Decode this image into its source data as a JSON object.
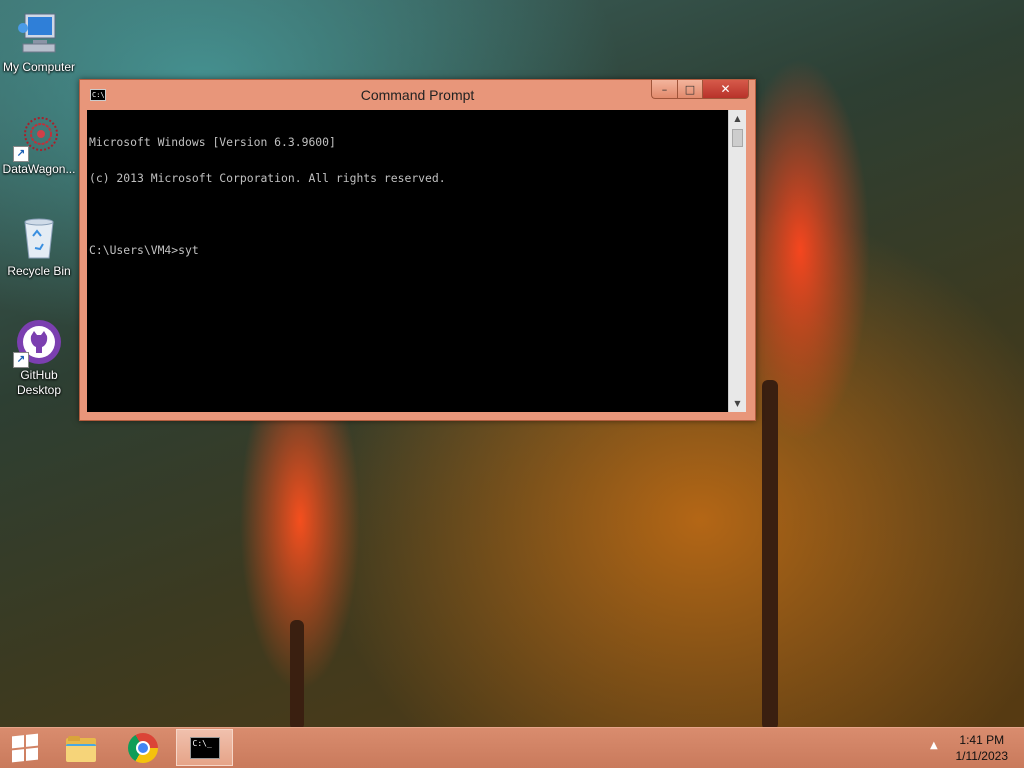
{
  "desktop": {
    "icons": [
      {
        "label": "My Computer",
        "icon": "computer-icon"
      },
      {
        "label": "DataWagon...",
        "icon": "datawagon-icon"
      },
      {
        "label": "Recycle Bin",
        "icon": "recycle-bin-icon"
      },
      {
        "label": "GitHub Desktop",
        "icon": "github-desktop-icon"
      }
    ]
  },
  "window": {
    "title": "Command Prompt",
    "title_icon_text": "C:\\",
    "minimize_glyph": "–",
    "maximize_glyph": "□",
    "close_glyph": "✕",
    "console_lines": [
      "Microsoft Windows [Version 6.3.9600]",
      "(c) 2013 Microsoft Corporation. All rights reserved.",
      "",
      "C:\\Users\\VM4>syt"
    ]
  },
  "taskbar": {
    "items": [
      {
        "name": "file-explorer",
        "icon": "folder-icon"
      },
      {
        "name": "chrome",
        "icon": "chrome-icon"
      },
      {
        "name": "command-prompt",
        "icon": "cmd-icon",
        "active": true,
        "icon_text": "C:\\_"
      }
    ],
    "tray_arrow": "▲",
    "clock": {
      "time": "1:41 PM",
      "date": "1/11/2023"
    }
  },
  "colors": {
    "window_frame": "#e8967a",
    "taskbar": "#d98c6e",
    "console_bg": "#000000",
    "console_fg": "#c0c0c0"
  }
}
